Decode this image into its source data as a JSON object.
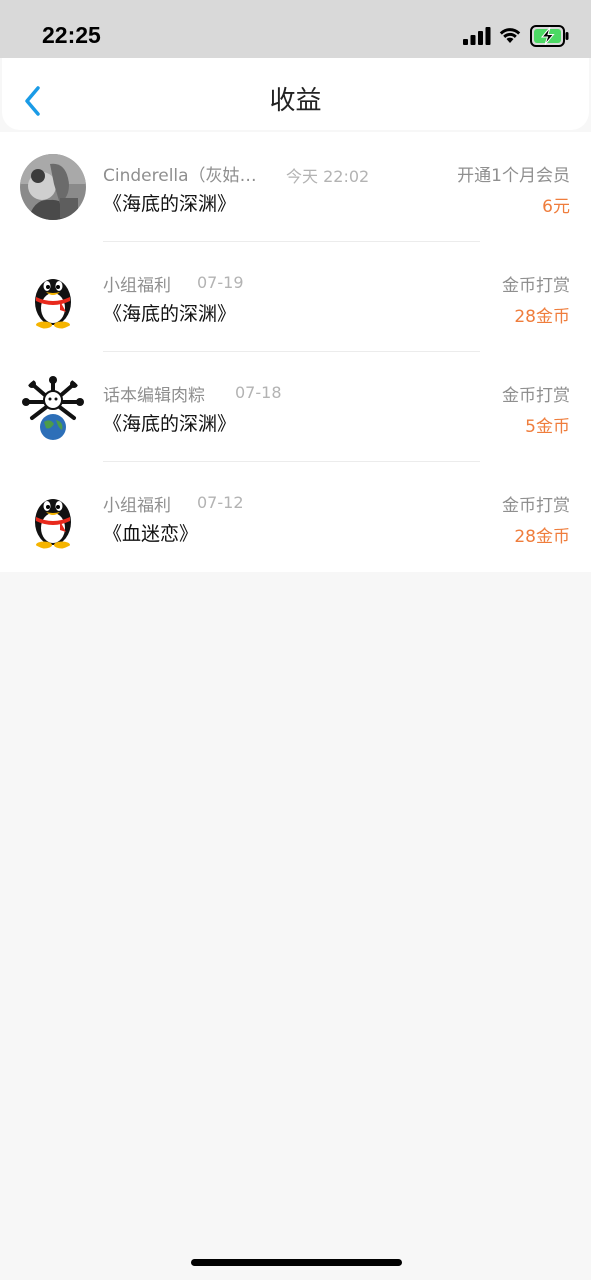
{
  "status_bar": {
    "time": "22:25",
    "icons": [
      "signal-icon",
      "wifi-icon",
      "battery-charging-icon"
    ]
  },
  "nav": {
    "title": "收益",
    "back_icon": "chevron-left-icon"
  },
  "colors": {
    "accent_orange": "#ef7d3c",
    "back_blue": "#1a9be6",
    "battery_green": "#4cd964"
  },
  "records": [
    {
      "user": "Cinderella（灰姑娘）",
      "time": "今天 22:02",
      "book": "《海底的深渊》",
      "type": "开通1个月会员",
      "amount": "6元",
      "avatar": "photo-avatar"
    },
    {
      "user": "小组福利",
      "time": "07-19",
      "book": "《海底的深渊》",
      "type": "金币打赏",
      "amount": "28金币",
      "avatar": "penguin-avatar"
    },
    {
      "user": "话本编辑肉粽",
      "time": "07-18",
      "book": "《海底的深渊》",
      "type": "金币打赏",
      "amount": "5金币",
      "avatar": "cartoon-globe-avatar"
    },
    {
      "user": "小组福利",
      "time": "07-12",
      "book": "《血迷恋》",
      "type": "金币打赏",
      "amount": "28金币",
      "avatar": "penguin-avatar"
    }
  ]
}
